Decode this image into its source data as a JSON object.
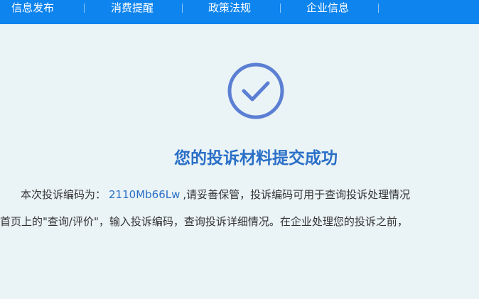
{
  "nav": {
    "items": [
      {
        "label": "信息发布"
      },
      {
        "label": "消费提醒"
      },
      {
        "label": "政策法规"
      },
      {
        "label": "企业信息"
      }
    ]
  },
  "success": {
    "icon": "check-circle-icon",
    "icon_color": "#5b7fd3",
    "title": "您的投诉材料提交成功"
  },
  "message": {
    "line1_prefix": "本次投诉编码为：",
    "complaint_code": "2110Mb66Lw",
    "line1_suffix": ",请妥善保管，投诉编码可用于查询投诉处理情况",
    "line2": "首页上的\"查询/评价\"，输入投诉编码，查询投诉详细情况。在企业处理您的投诉之前，"
  },
  "colors": {
    "nav_bg": "#0d84ee",
    "page_bg": "#eaf3f6",
    "title": "#2a6fc7",
    "code": "#2a6fc7"
  }
}
